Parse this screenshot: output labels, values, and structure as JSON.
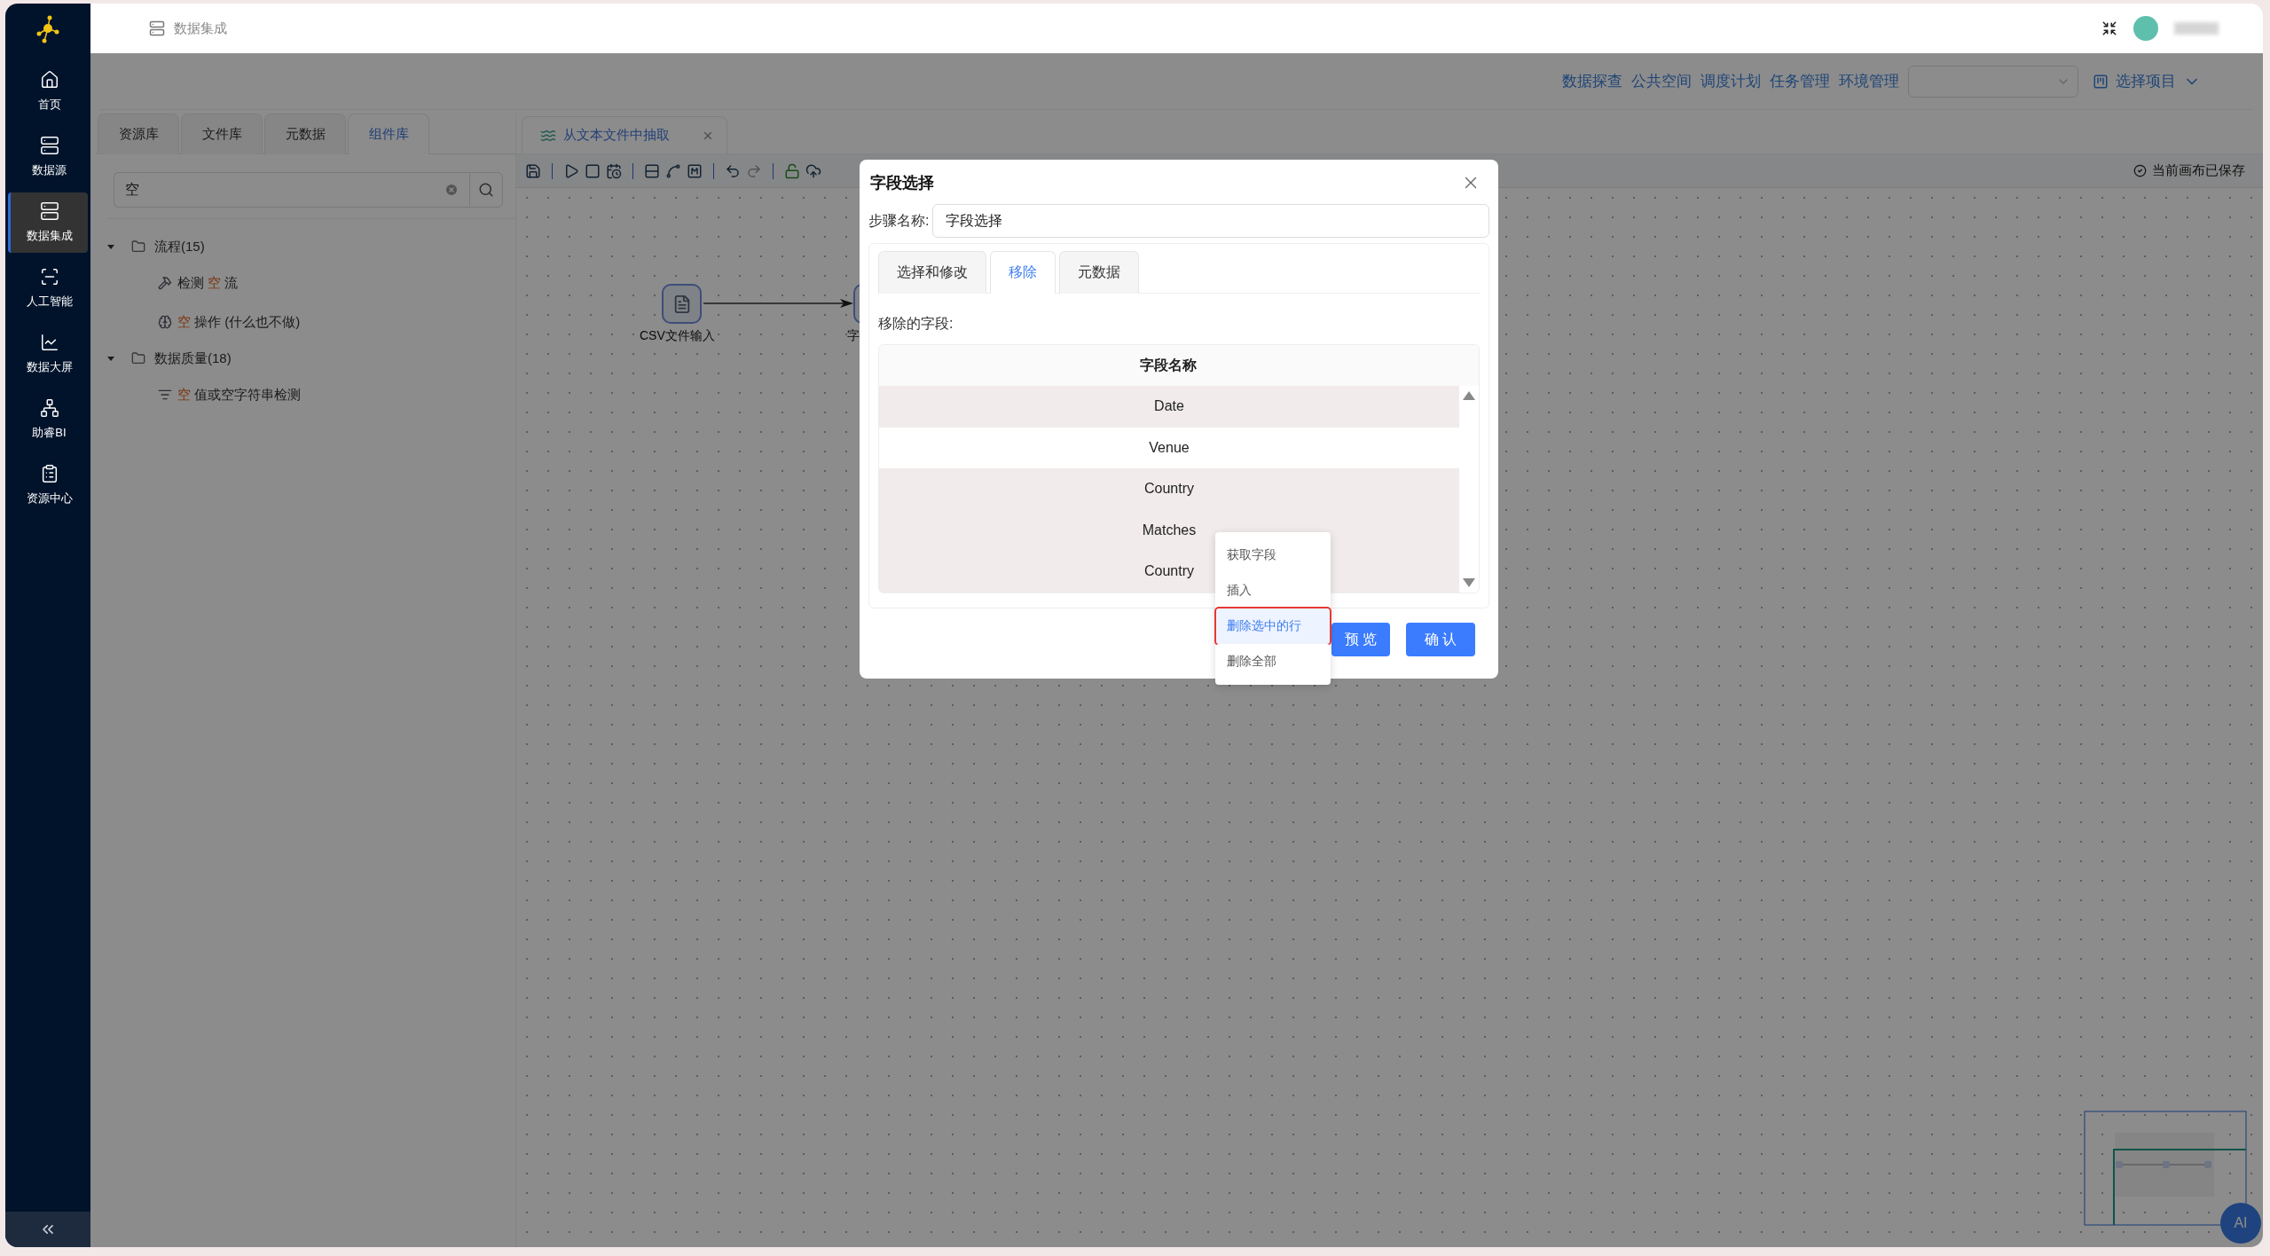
{
  "header": {
    "title": "数据集成"
  },
  "sidebar": {
    "items": [
      {
        "label": "首页",
        "selected": false
      },
      {
        "label": "数据源",
        "selected": false
      },
      {
        "label": "数据集成",
        "selected": true
      },
      {
        "label": "人工智能",
        "selected": false
      },
      {
        "label": "数据大屏",
        "selected": false
      },
      {
        "label": "助睿BI",
        "selected": false
      },
      {
        "label": "资源中心",
        "selected": false
      }
    ]
  },
  "top_nav": {
    "links": [
      "数据探查",
      "公共空间",
      "调度计划",
      "任务管理",
      "环境管理"
    ],
    "project_select": {
      "label": "选择项目"
    }
  },
  "left_panel": {
    "tabs": [
      {
        "label": "资源库",
        "selected": false
      },
      {
        "label": "文件库",
        "selected": false
      },
      {
        "label": "元数据",
        "selected": false
      },
      {
        "label": "组件库",
        "selected": true
      }
    ],
    "search": {
      "value": "空"
    },
    "tree": [
      {
        "label": "流程(15)",
        "expanded": true,
        "children": [
          {
            "kind": "flow",
            "parts": [
              {
                "text": "检测 ",
                "match": false
              },
              {
                "text": "空",
                "match": true
              },
              {
                "text": " 流",
                "match": false
              }
            ]
          },
          {
            "kind": "operation",
            "parts": [
              {
                "text": "空",
                "match": true
              },
              {
                "text": " 操作 (什么也不做)",
                "match": false
              }
            ]
          }
        ]
      },
      {
        "label": "数据质量(18)",
        "expanded": true,
        "children": [
          {
            "kind": "check",
            "parts": [
              {
                "text": "空",
                "match": true
              },
              {
                "text": " 值或空字符串检测",
                "match": false
              }
            ]
          }
        ]
      }
    ]
  },
  "editor": {
    "tabs": [
      {
        "label": "从文本文件中抽取",
        "selected": true
      }
    ],
    "save_status": "当前画布已保存",
    "nodes": [
      {
        "label": "CSV文件输入"
      },
      {
        "label": "字"
      }
    ]
  },
  "dialog": {
    "title": "字段选择",
    "step_label": "步骤名称:",
    "step_value": "字段选择",
    "tabs": [
      {
        "label": "选择和修改",
        "selected": false
      },
      {
        "label": "移除",
        "selected": true
      },
      {
        "label": "元数据",
        "selected": false
      }
    ],
    "section_label": "移除的字段:",
    "table": {
      "columns": [
        "字段名称"
      ],
      "rows": [
        {
          "cells": [
            "Date"
          ],
          "selected": true
        },
        {
          "cells": [
            "Venue"
          ],
          "selected": false
        },
        {
          "cells": [
            "Country"
          ],
          "selected": true
        },
        {
          "cells": [
            "Matches"
          ],
          "selected": true
        },
        {
          "cells": [
            "Country"
          ],
          "selected": true
        }
      ]
    },
    "buttons": [
      {
        "label": "预 览"
      },
      {
        "label": "确 认"
      }
    ]
  },
  "context_menu": {
    "items": [
      {
        "label": "获取字段",
        "selected": false
      },
      {
        "label": "插入",
        "selected": false
      },
      {
        "label": "删除选中的行",
        "selected": true
      },
      {
        "label": "删除全部",
        "selected": false
      }
    ]
  },
  "ai_button": {
    "label": "AI"
  }
}
